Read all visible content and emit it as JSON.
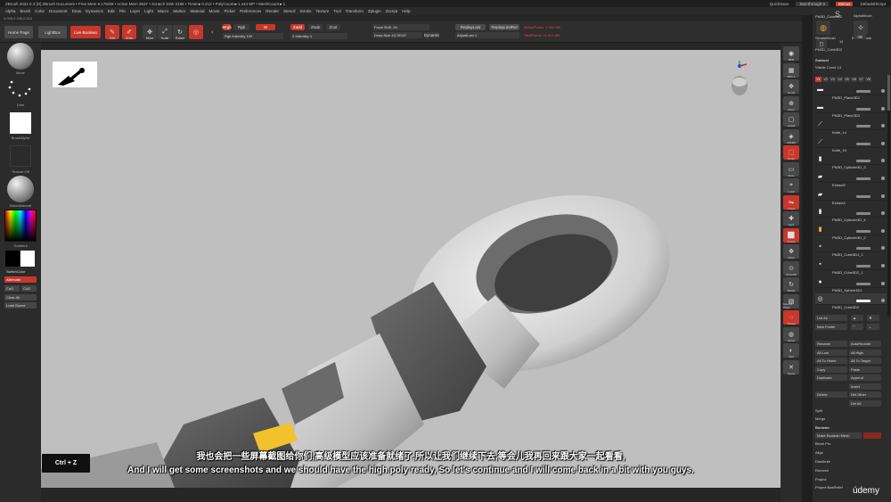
{
  "titlebar": {
    "app": "ZBrush 2022.0.3 [D]   ZBrush Document   • Free Mem 8.175GB • Active Mem 3537 • Scratch Disk 3188 • Timer►0.212 • PolyCount►1.444 MP • MeshCount►1",
    "quicksave": "QuickSave",
    "seethrough": "See-through 0",
    "menus": "Menus",
    "script": "DefaultZScript"
  },
  "menubar": [
    "Alpha",
    "Brush",
    "Color",
    "Document",
    "Draw",
    "Dynamics",
    "Edit",
    "File",
    "Layer",
    "Light",
    "Macro",
    "Marker",
    "Material",
    "Movie",
    "Picker",
    "Preferences",
    "Render",
    "Stencil",
    "Stroke",
    "Texture",
    "Tool",
    "Transform",
    "Zplugin",
    "Zscript",
    "Help"
  ],
  "coords": "0.095,2.436,0.013",
  "topbar": {
    "home": "Home Page",
    "lightbox": "LightBox",
    "live_boolean": "Live Boolean",
    "edit": "Edit",
    "draw": "Draw",
    "move": "Move",
    "scale": "Scale",
    "rotate": "Rotate",
    "mrgb": "Mrgb",
    "rgb": "Rgb",
    "m": "M",
    "zadd": "Zadd",
    "zsub": "Zsub",
    "zcut": "Zcut",
    "rgb_intensity_label": "Rgb Intensity",
    "rgb_intensity_value": "100",
    "z_intensity_label": "Z Intensity",
    "z_intensity_value": "4",
    "focal_shift_label": "Focal Shift",
    "focal_shift_value": "-34",
    "draw_size_label": "Draw Size",
    "draw_size_value": "43.76337",
    "dynamic": "Dynamic",
    "replay_last": "ReplayLast",
    "replay_last_rel": "ReplayLastRel",
    "adjust_last_label": "AdjustLast",
    "adjust_last_value": "1",
    "active_points": "ActivePoints: 1.444 Mil",
    "total_points": "TotalPoints: 11.601 Mil"
  },
  "leftpanel": {
    "brush_caption": "Move",
    "stroke_caption": "Dots",
    "alpha_caption": "BrushAlpha",
    "texture_caption": "Texture Off",
    "material_caption": "BasicMaterial",
    "gradient_label": "Gradient",
    "switch_color": "SwitchColor",
    "alternate": "Alternate",
    "color1": "Col1",
    "color2": "Col2",
    "clear_all": "Clear All",
    "load_saved": "Load Saved",
    "primary_color": "#000000",
    "secondary_color": "#ffffff"
  },
  "viewport": {
    "subtitle_zh": "我也会把一些屏幕截图给你们,高级模型应该准备就绪了,所以让我们继续下去,等会儿我再回来跟大家一起看看,",
    "subtitle_en": "And I will get some screenshots and we should have the high poly ready, So let's continue and I will come back in a bit with you guys.",
    "shortcut": "Ctrl + Z",
    "model_color": "#d8d8d8",
    "highlight_color": "#f2c22c"
  },
  "rstrip": [
    {
      "icon": "bpr-icon",
      "label": "BPR"
    },
    {
      "icon": "spix-icon",
      "label": "SPix 3"
    },
    {
      "icon": "scroll-icon",
      "label": "Scroll"
    },
    {
      "icon": "zoom-icon",
      "label": "Zoom"
    },
    {
      "icon": "actual-icon",
      "label": "Actual"
    },
    {
      "icon": "aahalf-icon",
      "label": "AAHalf"
    },
    {
      "icon": "persp-icon",
      "label": "Persp"
    },
    {
      "icon": "floor-icon",
      "label": "Floor"
    },
    {
      "icon": "local-icon",
      "label": "Local"
    },
    {
      "icon": "lsym-icon",
      "label": "L.Sym"
    },
    {
      "icon": "xyz-icon",
      "label": "Gxyz"
    },
    {
      "icon": "frame-icon",
      "label": "Frame"
    },
    {
      "icon": "move-icon",
      "label": "Move"
    },
    {
      "icon": "zoom3d-icon",
      "label": "Zoom3D"
    },
    {
      "icon": "rotate-icon",
      "label": "Rotate"
    },
    {
      "icon": "linefill-icon",
      "label": "Line Fill PolyF"
    },
    {
      "icon": "transp-icon",
      "label": "Transp"
    },
    {
      "icon": "ghost-icon",
      "label": "Ghost"
    },
    {
      "icon": "solo-icon",
      "label": "Solo"
    },
    {
      "icon": "xpose-icon",
      "label": "Xpose"
    }
  ],
  "rpanel": {
    "tool_name": "PM3D_Cube3D2",
    "alpha_brush": "AlphaBrush",
    "simple_brush": "SimpleBrush",
    "eraser_brush": "EraserBrush",
    "tool_count": "14",
    "tool_current": "PM3D_Cube3D2",
    "subtool_title": "Subtool",
    "visible_count": "Visible Count 14",
    "num_tabs": [
      "V1",
      "V2",
      "V3",
      "V4",
      "V5",
      "V6",
      "V7",
      "V8"
    ],
    "subtools": [
      {
        "name": "PM3D_Plane3D2",
        "icon": "plane-icon"
      },
      {
        "name": "PM3D_Plane3D3",
        "icon": "plane-icon"
      },
      {
        "name": "Knife_14",
        "icon": "knife-icon"
      },
      {
        "name": "Knife_15",
        "icon": "knife-icon"
      },
      {
        "name": "PM3D_Cylinder3D_3",
        "icon": "cylinder-icon"
      },
      {
        "name": "Extract5",
        "icon": "extract-icon"
      },
      {
        "name": "Extract4",
        "icon": "extract-icon"
      },
      {
        "name": "PM3D_Cylinder3D_4",
        "icon": "cylinder-icon"
      },
      {
        "name": "PM3D_Cylinder3D_2",
        "icon": "cylinder-icon"
      },
      {
        "name": "PM3D_Cube3D1_1",
        "icon": "cube-icon"
      },
      {
        "name": "PM3D_Cube3D2_1",
        "icon": "cube-icon"
      },
      {
        "name": "PM3D_Sphere3D1",
        "icon": "sphere-icon"
      },
      {
        "name": "PM3D_Cube3D2",
        "icon": "ring-icon"
      }
    ],
    "list_all": "List All",
    "new_folder": "New Folder",
    "ops": [
      [
        "Rename",
        "AutoReorder"
      ],
      [
        "All Low",
        "All High"
      ],
      [
        "All To Home",
        "All To Target"
      ],
      [
        "Copy",
        "Paste"
      ],
      [
        "Duplicate",
        "Append"
      ],
      [
        "",
        "Insert"
      ],
      [
        "Delete",
        "Del Other"
      ],
      [
        "",
        "Del All"
      ]
    ],
    "split": "Split",
    "merge": "Merge",
    "boolean": "Boolean",
    "make_boolean_mesh": "Make Boolean Mesh",
    "bevel_pro": "Bevel Pro",
    "align": "Align",
    "distribute": "Distribute",
    "remesh": "Remesh",
    "project": "Project",
    "project_bas_relief": "Project BasRelief"
  },
  "watermark": "údemy"
}
